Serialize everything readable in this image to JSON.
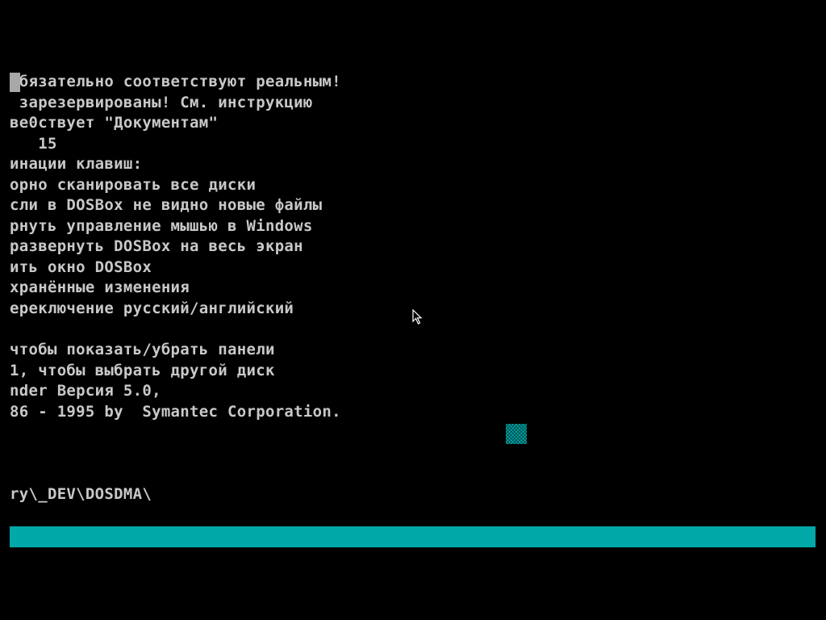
{
  "terminal": {
    "lines": [
      "обязательно соответствуют реальным!",
      " зарезервированы! См. инструкцию",
      "ве0ствует \"Документам\"",
      "   15",
      "инации клавиш:",
      "орно сканировать все диски",
      "сли в DOSBox не видно новые файлы",
      "рнуть управление мышью в Windows",
      "развернуть DOSBox на весь экран",
      "ить окно DOSBox",
      "хранённые изменения",
      "ереключение русский/английский",
      "",
      "чтобы показать/убрать панели",
      "1, чтобы выбрать другой диск",
      "nder Версия 5.0,",
      "86 - 1995 by  Symantec Corporation."
    ],
    "prompt_path": "ry\\_DEV\\DOSDMA\\"
  },
  "colors": {
    "background": "#000000",
    "text": "#c8c8c8",
    "cursor": "#a8a8a8",
    "cyan": "#00a8a8"
  },
  "icons": {
    "pointer": "mouse-pointer-icon"
  }
}
